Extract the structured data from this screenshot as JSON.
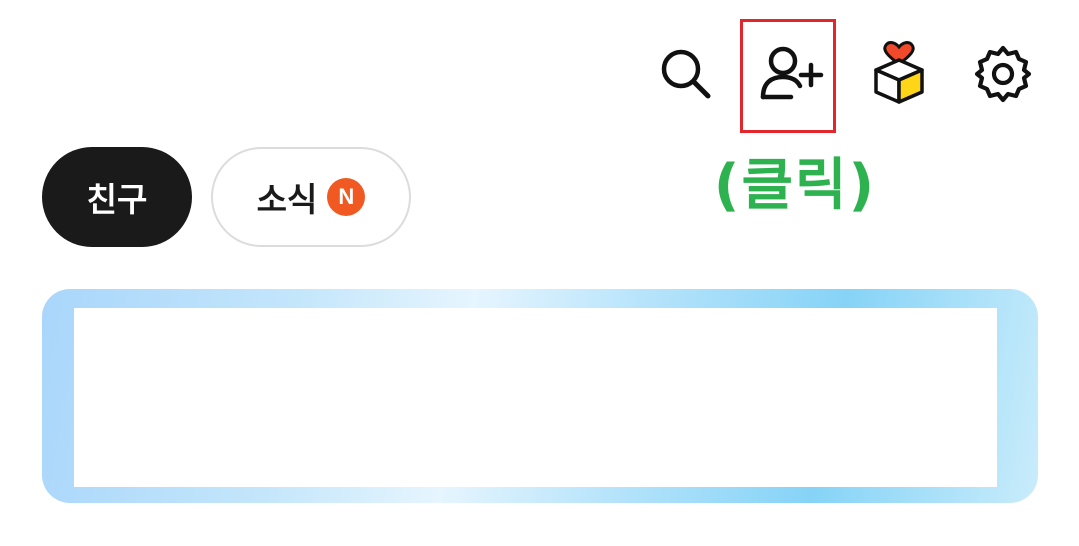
{
  "header": {
    "icons": {
      "search": "search-icon",
      "add_friend": "add-friend-icon",
      "gift": "gift-box-icon",
      "settings": "gear-icon"
    }
  },
  "annotation": {
    "click_label": "(클릭)",
    "highlight_color": "#e3262b",
    "label_color": "#2eb24f"
  },
  "tabs": [
    {
      "label": "친구",
      "active": true
    },
    {
      "label": "소식",
      "badge": "N",
      "active": false
    }
  ],
  "colors": {
    "active_tab_bg": "#1a1a1a",
    "badge": "#f05a22",
    "banner_gradient_start": "#a9d6fb",
    "banner_gradient_end": "#86d3f7"
  }
}
